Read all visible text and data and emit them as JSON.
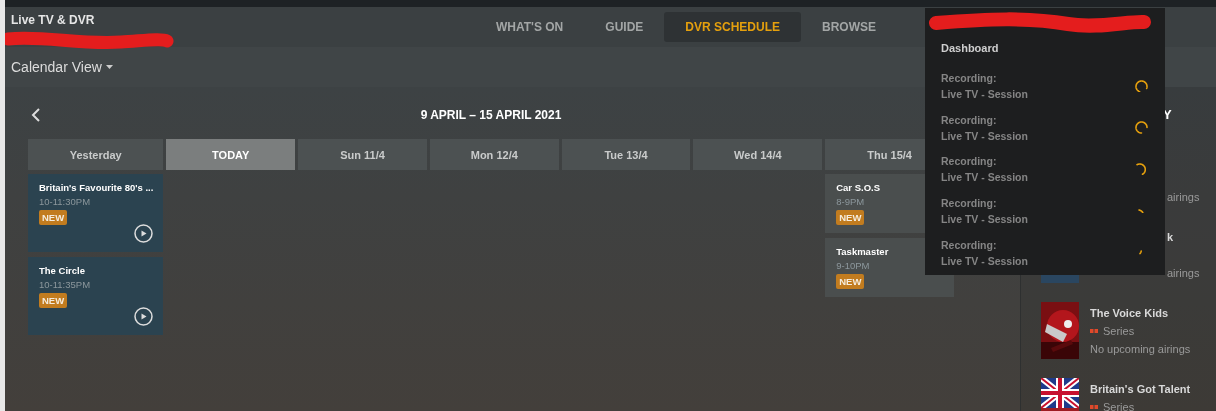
{
  "header": {
    "title": "Live TV & DVR",
    "nav": [
      {
        "label": "WHAT'S ON",
        "selected": false
      },
      {
        "label": "GUIDE",
        "selected": false
      },
      {
        "label": "DVR SCHEDULE",
        "selected": true
      },
      {
        "label": "BROWSE",
        "selected": false
      }
    ]
  },
  "view_menu": {
    "label": "Calendar View"
  },
  "calendar": {
    "range": "9 APRIL – 15 APRIL 2021",
    "days": [
      {
        "label": "Yesterday",
        "selected": false,
        "events": [
          {
            "title": "Britain's Favourite 80's ...",
            "time": "10-11:30PM",
            "badge": "NEW",
            "playable": true
          },
          {
            "title": "The Circle",
            "time": "10-11:35PM",
            "badge": "NEW",
            "playable": true
          }
        ]
      },
      {
        "label": "TODAY",
        "selected": true
      },
      {
        "label": "Sun 11/4",
        "selected": false
      },
      {
        "label": "Mon 12/4",
        "selected": false
      },
      {
        "label": "Tue 13/4",
        "selected": false
      },
      {
        "label": "Wed 14/4",
        "selected": false
      },
      {
        "label": "Thu 15/4",
        "selected": false,
        "events": [
          {
            "title": "Car S.O.S",
            "time": "8-9PM",
            "badge": "NEW",
            "playable": false
          },
          {
            "title": "Taskmaster",
            "time": "9-10PM",
            "badge": "NEW",
            "playable": false
          }
        ]
      }
    ]
  },
  "sidebar": {
    "heading": "Y",
    "items": [
      {
        "kind": "covered",
        "status": "airings"
      },
      {
        "kind": "covered",
        "title": "k",
        "status": "airings"
      },
      {
        "kind": "show",
        "title": "The Voice Kids",
        "type": "Series",
        "status": "No upcoming airings"
      },
      {
        "kind": "show",
        "title": "Britain's Got Talent",
        "type": "Series"
      }
    ]
  },
  "menu": {
    "heading": "Dashboard",
    "sessions": [
      {
        "label": "Recording:",
        "title": "Live TV - Session"
      },
      {
        "label": "Recording:",
        "title": "Live TV - Session"
      },
      {
        "label": "Recording:",
        "title": "Live TV - Session"
      },
      {
        "label": "Recording:",
        "title": "Live TV - Session"
      },
      {
        "label": "Recording:",
        "title": "Live TV - Session"
      }
    ]
  }
}
